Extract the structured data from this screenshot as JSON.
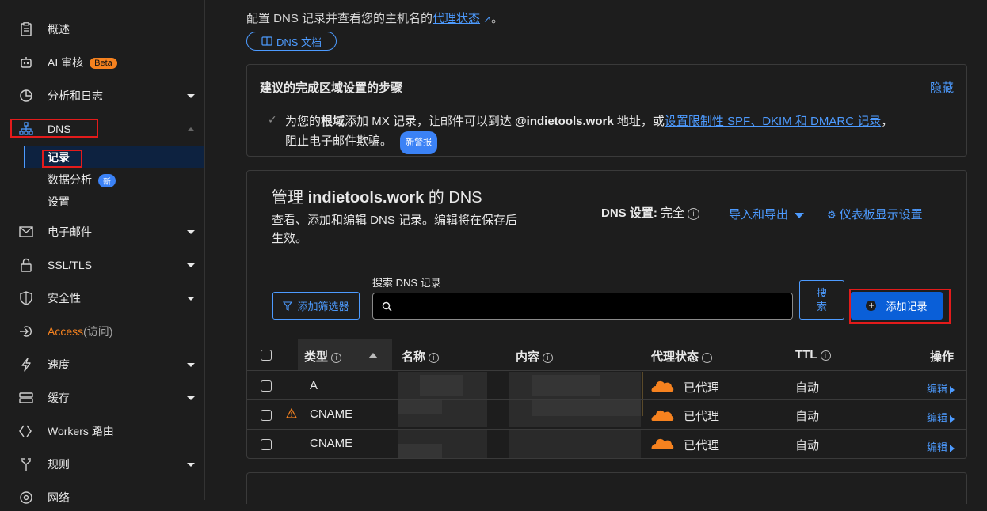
{
  "sidebar": {
    "items": [
      {
        "label": "概述",
        "icon": "clipboard-icon"
      },
      {
        "label": "AI 审核",
        "badge": "Beta",
        "icon": "robot-icon"
      },
      {
        "label": "分析和日志",
        "icon": "pie-chart-icon"
      },
      {
        "label": "DNS",
        "icon": "sitemap-icon"
      },
      {
        "label": "电子邮件",
        "icon": "mail-icon"
      },
      {
        "label": "SSL/TLS",
        "icon": "lock-icon"
      },
      {
        "label": "安全性",
        "icon": "shield-icon"
      },
      {
        "label": "Access",
        "suffix": "(访问)",
        "icon": "access-icon"
      },
      {
        "label": "速度",
        "icon": "lightning-icon"
      },
      {
        "label": "缓存",
        "icon": "server-icon"
      },
      {
        "label": "Workers 路由",
        "icon": "workers-icon"
      },
      {
        "label": "规则",
        "icon": "fork-icon"
      },
      {
        "label": "网络",
        "icon": "globe-icon"
      }
    ],
    "dns_sub": [
      {
        "label": "记录"
      },
      {
        "label": "数据分析",
        "badge": "新"
      },
      {
        "label": "设置"
      }
    ]
  },
  "header": {
    "description_prefix": "配置 DNS 记录并查看您的主机名的",
    "description_link": "代理状态",
    "description_suffix": "。",
    "docs_button": "DNS 文档"
  },
  "steps_card": {
    "title": "建议的完成区域设置的步骤",
    "hide_link": "隐藏",
    "text_1": "为您的",
    "text_bold_1": "根域",
    "text_2": "添加 MX 记录，让邮件可以到达 ",
    "text_bold_2": "@indietools.work",
    "text_3": " 地址，或",
    "text_link": "设置限制性 SPF、DKIM 和 DMARC 记录",
    "text_4": "，",
    "text_line2": "阻止电子邮件欺骗。",
    "tag": "新警报"
  },
  "manage": {
    "title_prefix": "管理 ",
    "title_domain": "indietools.work",
    "title_suffix": " 的 DNS",
    "desc_line1": "查看、添加和编辑 DNS 记录。编辑将在保存后",
    "desc_line2": "生效。",
    "dns_setting_label": "DNS 设置:",
    "dns_setting_value": "完全",
    "import_export": "导入和导出",
    "dashboard_settings": "仪表板显示设置",
    "search_label": "搜索 DNS 记录",
    "search_placeholder": "",
    "filter_button": "添加筛选器",
    "search_button": "搜索",
    "add_record_button": "添加记录"
  },
  "table": {
    "headers": [
      "类型",
      "名称",
      "内容",
      "代理状态",
      "TTL",
      "操作"
    ],
    "rows": [
      {
        "type": "A",
        "warning": false,
        "proxy": "已代理",
        "ttl": "自动",
        "action": "编辑"
      },
      {
        "type": "CNAME",
        "warning": true,
        "proxy": "已代理",
        "ttl": "自动",
        "action": "编辑"
      },
      {
        "type": "CNAME",
        "warning": false,
        "proxy": "已代理",
        "ttl": "自动",
        "action": "编辑"
      }
    ]
  },
  "colors": {
    "accent": "#4d9bff",
    "primary": "#0a5fd8",
    "brand_orange": "#f6821f",
    "highlight": "#e31b1b"
  }
}
